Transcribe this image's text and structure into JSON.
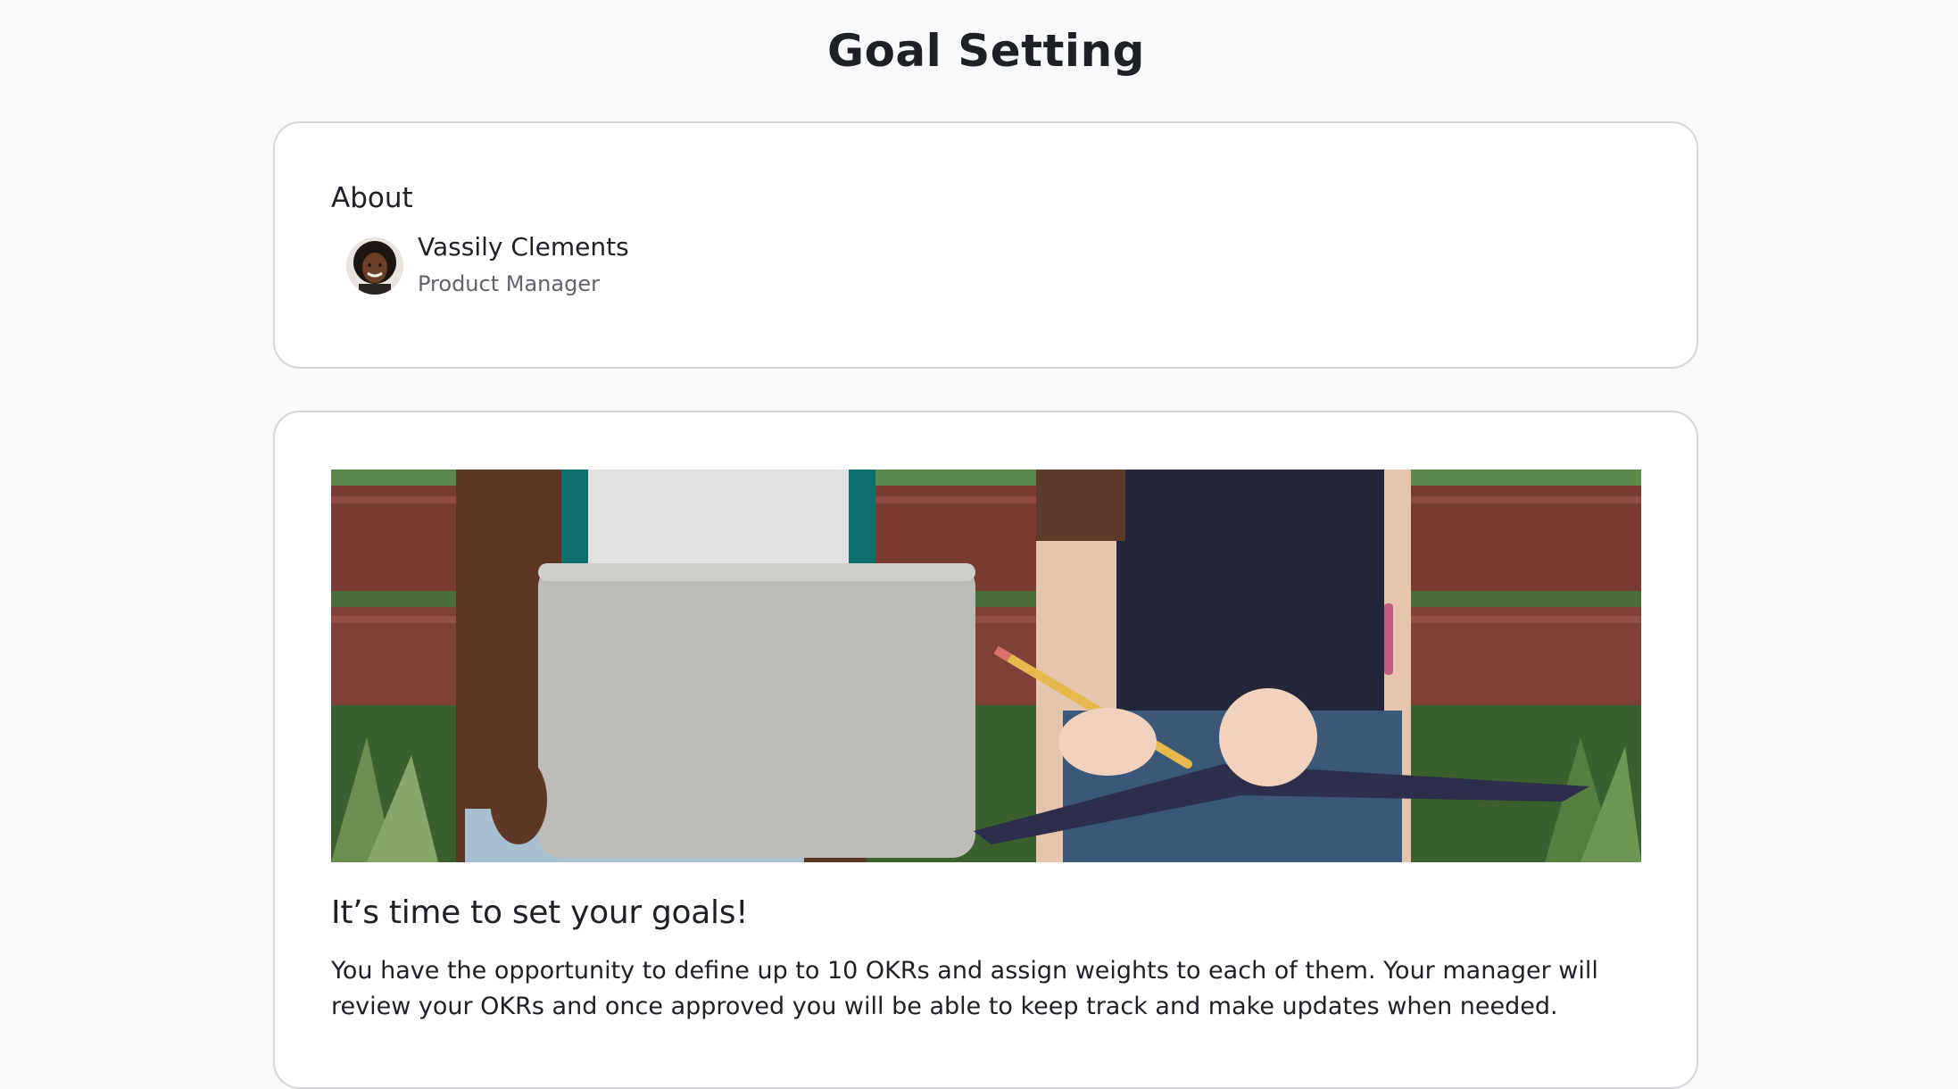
{
  "page": {
    "title": "Goal Setting"
  },
  "about": {
    "heading": "About",
    "user": {
      "name": "Vassily Clements",
      "role": "Product Manager"
    }
  },
  "intro": {
    "image": "students-laptop-notebook-bench-photo",
    "heading": "It’s time to set your goals!",
    "body": "You have the opportunity to define up to 10 OKRs and assign weights to each of them. Your manager will review your OKRs and once approved you will be able to keep track and make updates when needed."
  }
}
